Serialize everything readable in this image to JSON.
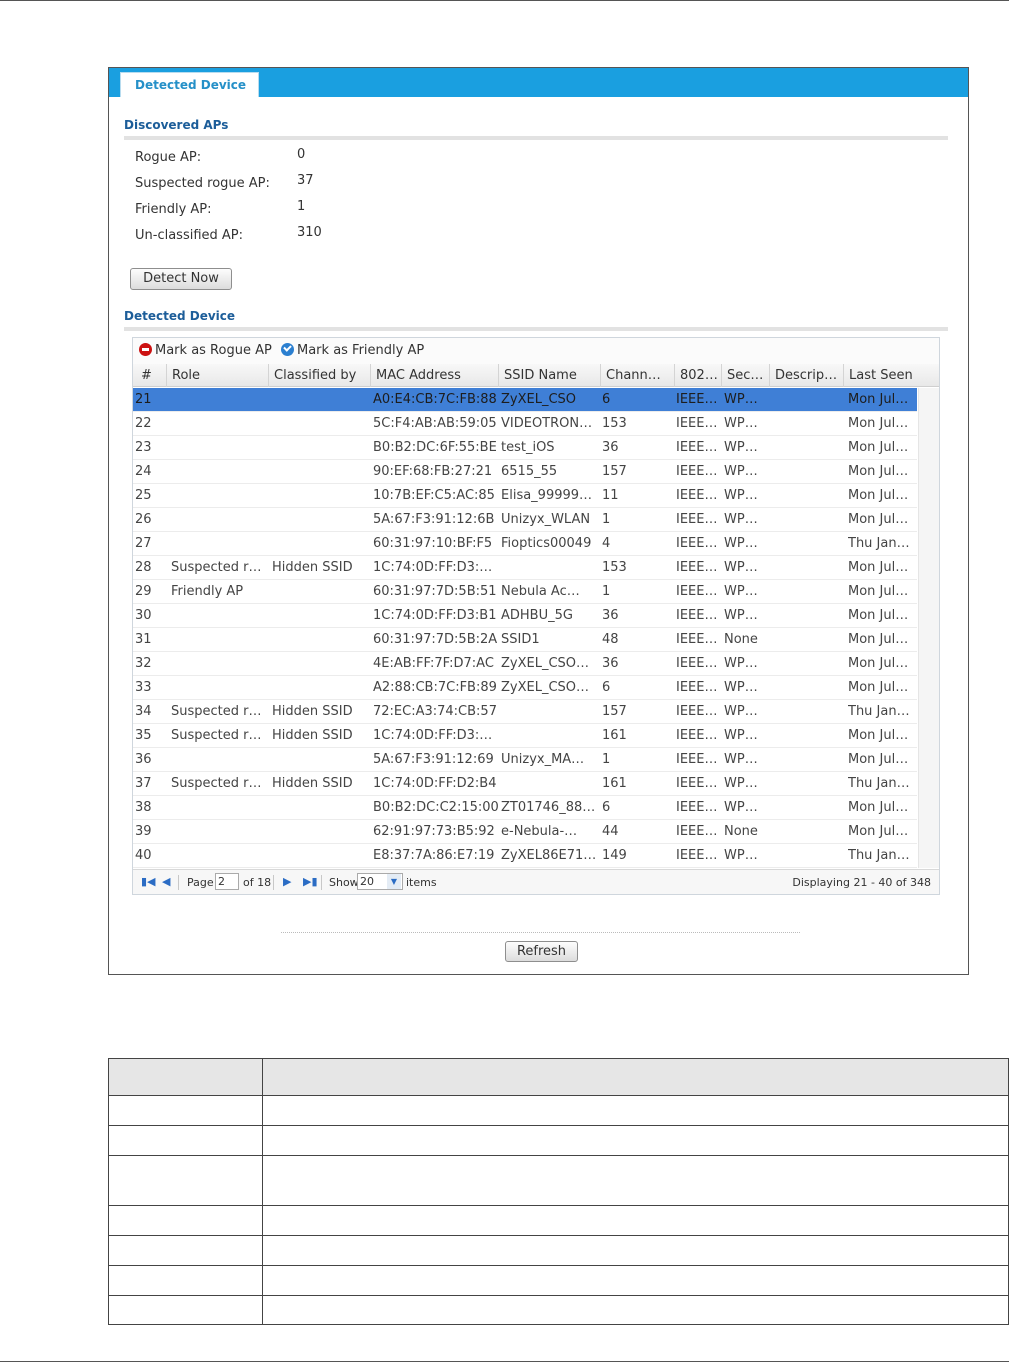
{
  "tab": {
    "label": "Detected Device"
  },
  "discovered": {
    "title": "Discovered APs",
    "items": [
      {
        "label": "Rogue AP:",
        "value": "0"
      },
      {
        "label": "Suspected rogue AP:",
        "value": "37"
      },
      {
        "label": "Friendly AP:",
        "value": "1"
      },
      {
        "label": "Un-classified AP:",
        "value": "310"
      }
    ],
    "detect_button": "Detect Now"
  },
  "detected": {
    "title": "Detected Device",
    "toolbar": {
      "mark_rogue": "Mark as Rogue AP",
      "mark_friendly": "Mark as Friendly AP"
    },
    "columns": [
      "#",
      "Role",
      "Classified by",
      "MAC Address",
      "SSID Name",
      "Chann…",
      "802…",
      "Sec…",
      "Descrip…",
      "Last Seen"
    ],
    "rows": [
      [
        "21",
        "",
        "",
        "A0:E4:CB:7C:FB:88",
        "ZyXEL_CSO",
        "6",
        "IEEE…",
        "WP…",
        "",
        "Mon Jul…"
      ],
      [
        "22",
        "",
        "",
        "5C:F4:AB:AB:59:05",
        "VIDEOTRON…",
        "153",
        "IEEE…",
        "WP…",
        "",
        "Mon Jul…"
      ],
      [
        "23",
        "",
        "",
        "B0:B2:DC:6F:55:BE",
        "test_iOS",
        "36",
        "IEEE…",
        "WP…",
        "",
        "Mon Jul…"
      ],
      [
        "24",
        "",
        "",
        "90:EF:68:FB:27:21",
        "6515_55",
        "157",
        "IEEE…",
        "WP…",
        "",
        "Mon Jul…"
      ],
      [
        "25",
        "",
        "",
        "10:7B:EF:C5:AC:85",
        "Elisa_99999…",
        "11",
        "IEEE…",
        "WP…",
        "",
        "Mon Jul…"
      ],
      [
        "26",
        "",
        "",
        "5A:67:F3:91:12:6B",
        "Unizyx_WLAN",
        "1",
        "IEEE…",
        "WP…",
        "",
        "Mon Jul…"
      ],
      [
        "27",
        "",
        "",
        "60:31:97:10:BF:F5",
        "Fioptics00049",
        "4",
        "IEEE…",
        "WP…",
        "",
        "Thu Jan…"
      ],
      [
        "28",
        "Suspected r…",
        "Hidden SSID",
        "1C:74:0D:FF:D3:…",
        "",
        "153",
        "IEEE…",
        "WP…",
        "",
        "Mon Jul…"
      ],
      [
        "29",
        "Friendly AP",
        "",
        "60:31:97:7D:5B:51",
        "Nebula Ac…",
        "1",
        "IEEE…",
        "WP…",
        "",
        "Mon Jul…"
      ],
      [
        "30",
        "",
        "",
        "1C:74:0D:FF:D3:B1",
        "ADHBU_5G",
        "36",
        "IEEE…",
        "WP…",
        "",
        "Mon Jul…"
      ],
      [
        "31",
        "",
        "",
        "60:31:97:7D:5B:2A",
        "SSID1",
        "48",
        "IEEE…",
        "None",
        "",
        "Mon Jul…"
      ],
      [
        "32",
        "",
        "",
        "4E:AB:FF:7F:D7:AC",
        "ZyXEL_CSO…",
        "36",
        "IEEE…",
        "WP…",
        "",
        "Mon Jul…"
      ],
      [
        "33",
        "",
        "",
        "A2:88:CB:7C:FB:89",
        "ZyXEL_CSO…",
        "6",
        "IEEE…",
        "WP…",
        "",
        "Mon Jul…"
      ],
      [
        "34",
        "Suspected r…",
        "Hidden SSID",
        "72:EC:A3:74:CB:57",
        "",
        "157",
        "IEEE…",
        "WP…",
        "",
        "Thu Jan…"
      ],
      [
        "35",
        "Suspected r…",
        "Hidden SSID",
        "1C:74:0D:FF:D3:…",
        "",
        "161",
        "IEEE…",
        "WP…",
        "",
        "Mon Jul…"
      ],
      [
        "36",
        "",
        "",
        "5A:67:F3:91:12:69",
        "Unizyx_MA…",
        "1",
        "IEEE…",
        "WP…",
        "",
        "Mon Jul…"
      ],
      [
        "37",
        "Suspected r…",
        "Hidden SSID",
        "1C:74:0D:FF:D2:B4",
        "",
        "161",
        "IEEE…",
        "WP…",
        "",
        "Thu Jan…"
      ],
      [
        "38",
        "",
        "",
        "B0:B2:DC:C2:15:00",
        "ZT01746_88…",
        "6",
        "IEEE…",
        "WP…",
        "",
        "Mon Jul…"
      ],
      [
        "39",
        "",
        "",
        "62:91:97:73:B5:92",
        "e-Nebula-…",
        "44",
        "IEEE…",
        "None",
        "",
        "Mon Jul…"
      ],
      [
        "40",
        "",
        "",
        "E8:37:7A:86:E7:19",
        "ZyXEL86E71…",
        "149",
        "IEEE…",
        "WP…",
        "",
        "Thu Jan…"
      ]
    ],
    "selected_row": 0,
    "pager": {
      "page_label": "Page",
      "page_value": "2",
      "of_label": "of 18",
      "show_label": "Show",
      "show_value": "20",
      "items_label": "items",
      "displaying": "Displaying 21 - 40 of 348"
    }
  },
  "refresh_button": "Refresh"
}
